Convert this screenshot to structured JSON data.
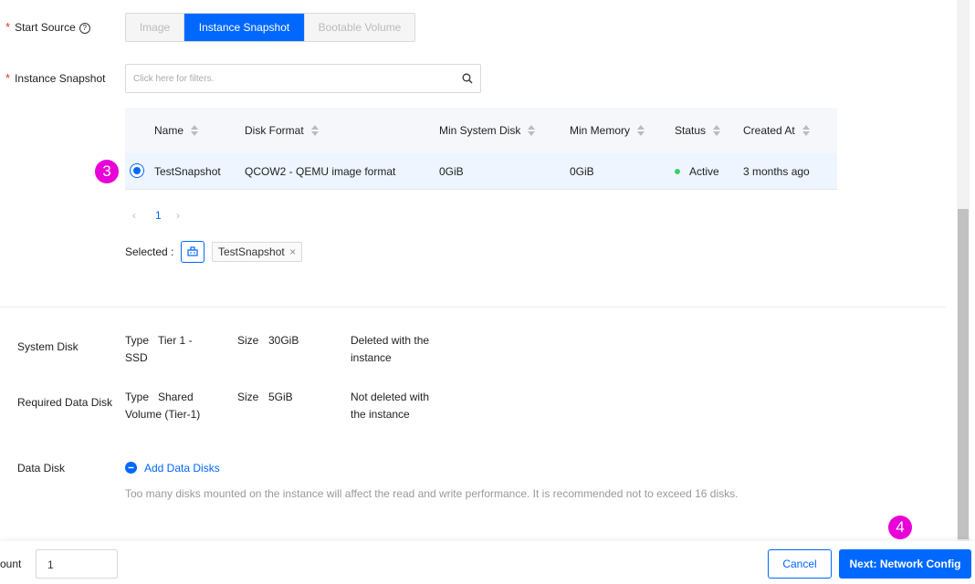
{
  "start_source": {
    "label": "Start Source",
    "help_icon": "help-circle-icon",
    "options": [
      "Image",
      "Instance Snapshot",
      "Bootable Volume"
    ],
    "selected": "Instance Snapshot"
  },
  "instance_snapshot": {
    "label": "Instance Snapshot",
    "search_placeholder": "Click here for filters.",
    "columns": [
      "Name",
      "Disk Format",
      "Min System Disk",
      "Min Memory",
      "Status",
      "Created At"
    ],
    "rows": [
      {
        "name": "TestSnapshot",
        "disk_format": "QCOW2 - QEMU image format",
        "min_system_disk": "0GiB",
        "min_memory": "0GiB",
        "status": "Active",
        "created_at": "3 months ago"
      }
    ],
    "page": "1",
    "selected_label": "Selected :",
    "selected_tag": "TestSnapshot",
    "tag_close": "×"
  },
  "badges": {
    "step3": "3",
    "step4": "4"
  },
  "system_disk": {
    "label": "System Disk",
    "type_label": "Type",
    "type_value": "Tier 1 - SSD",
    "size_label": "Size",
    "size_value": "30GiB",
    "delete_note": "Deleted with the instance"
  },
  "required_data_disk": {
    "label": "Required Data Disk",
    "type_label": "Type",
    "type_value": "Shared Volume (Tier-1)",
    "size_label": "Size",
    "size_value": "5GiB",
    "delete_note": "Not deleted with the instance"
  },
  "data_disk": {
    "label": "Data Disk",
    "add_label": "Add Data Disks",
    "note": "Too many disks mounted on the instance will affect the read and write performance. It is recommended not to exceed 16 disks."
  },
  "footer": {
    "count_label": "ount",
    "count_value": "1",
    "cancel_label": "Cancel",
    "next_label": "Next: Network Config"
  },
  "colors": {
    "accent": "#0068ff",
    "badge": "#e900d8",
    "status_active": "#3bcf6e"
  }
}
